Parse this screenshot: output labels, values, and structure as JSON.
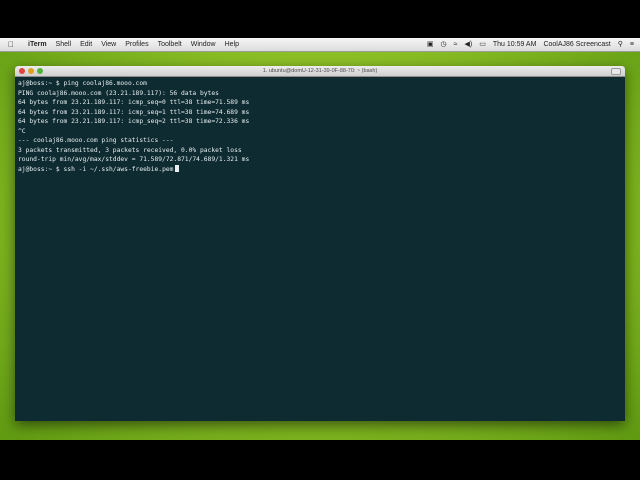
{
  "menubar": {
    "apple_icon": "apple-icon",
    "items": [
      "iTerm",
      "Shell",
      "Edit",
      "View",
      "Profiles",
      "Toolbelt",
      "Window",
      "Help"
    ],
    "clock": "Thu 10:59 AM",
    "user": "CoolAJ86 Screencast",
    "status_icons": [
      "dropbox-icon",
      "time-machine-icon",
      "wifi-icon",
      "volume-icon",
      "battery-icon",
      "spotlight-icon",
      "list-icon"
    ]
  },
  "window": {
    "title": "1. ubuntu@domU-12-31-39-0F-88-70: ~ (bash)"
  },
  "terminal": {
    "lines": [
      "aj@boss:~ $ ping coolaj86.mooo.com",
      "PING coolaj86.mooo.com (23.21.189.117): 56 data bytes",
      "64 bytes from 23.21.189.117: icmp_seq=0 ttl=38 time=71.589 ms",
      "64 bytes from 23.21.189.117: icmp_seq=1 ttl=38 time=74.689 ms",
      "64 bytes from 23.21.189.117: icmp_seq=2 ttl=38 time=72.336 ms",
      "^C",
      "--- coolaj86.mooo.com ping statistics ---",
      "3 packets transmitted, 3 packets received, 0.0% packet loss",
      "round-trip min/avg/max/stddev = 71.589/72.871/74.689/1.321 ms"
    ],
    "prompt": "aj@boss:~ $ ",
    "current_input": "ssh -i ~/.ssh/aws-freebie.pem"
  },
  "colors": {
    "terminal_bg": "#0d2b31",
    "terminal_fg": "#e8eef0",
    "wallpaper": "#93c628"
  }
}
